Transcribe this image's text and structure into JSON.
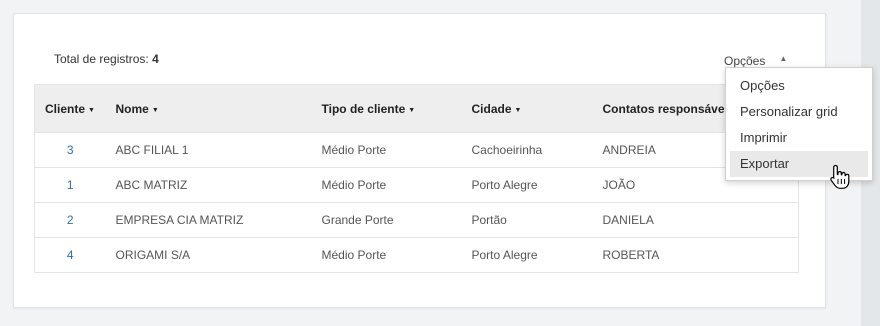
{
  "summary": {
    "total_label": "Total de registros:",
    "total_value": "4"
  },
  "options": {
    "label": "Opções",
    "caret_icon": "caret-up-icon"
  },
  "grid": {
    "headers": [
      {
        "label": "Cliente"
      },
      {
        "label": "Nome"
      },
      {
        "label": "Tipo de cliente"
      },
      {
        "label": "Cidade"
      },
      {
        "label": "Contatos responsáveis"
      }
    ],
    "rows": [
      {
        "cliente": "3",
        "nome": "ABC FILIAL 1",
        "tipo": "Médio Porte",
        "cidade": "Cachoeirinha",
        "contato": "ANDREIA"
      },
      {
        "cliente": "1",
        "nome": "ABC MATRIZ",
        "tipo": "Médio Porte",
        "cidade": "Porto Alegre",
        "contato": "JOÃO"
      },
      {
        "cliente": "2",
        "nome": "EMPRESA CIA MATRIZ",
        "tipo": "Grande Porte",
        "cidade": "Portão",
        "contato": "DANIELA"
      },
      {
        "cliente": "4",
        "nome": "ORIGAMI S/A",
        "tipo": "Médio Porte",
        "cidade": "Porto Alegre",
        "contato": "ROBERTA"
      }
    ]
  },
  "menu": {
    "items": [
      {
        "label": "Opções"
      },
      {
        "label": "Personalizar grid"
      },
      {
        "label": "Imprimir"
      },
      {
        "label": "Exportar"
      }
    ],
    "hovered_index": 3
  },
  "colors": {
    "link": "#2f6fa8",
    "header_bg": "#eeeeee",
    "hover_bg": "#e9e9e9"
  }
}
